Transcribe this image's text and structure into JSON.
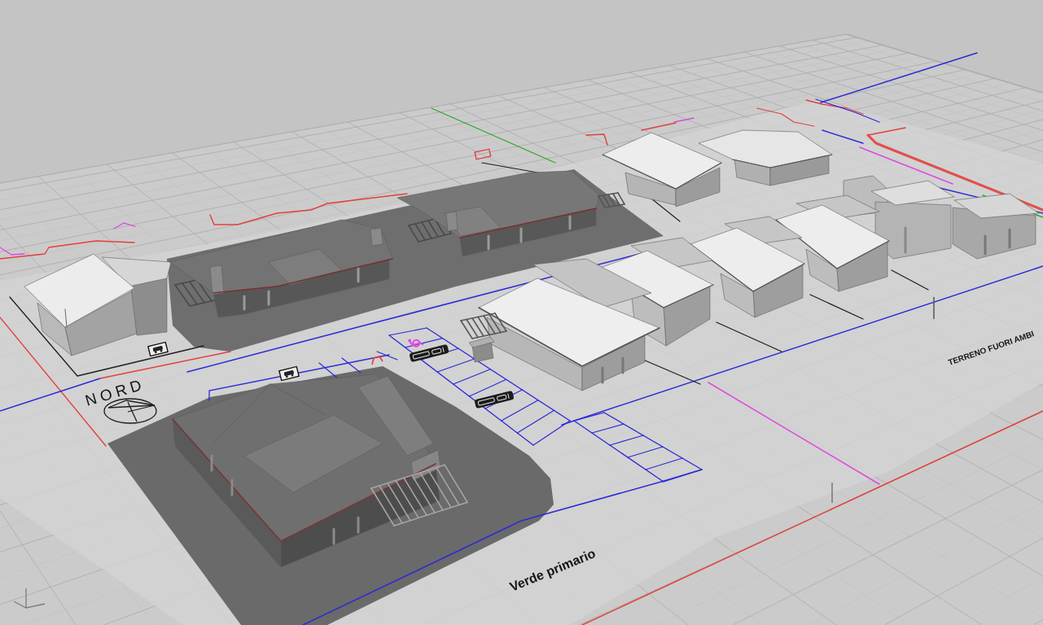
{
  "viewport": {
    "north_arrow": {
      "label": "NORD"
    },
    "zone_labels": [
      {
        "text": "Verde primario"
      },
      {
        "text": "TERRENO FUORI AMBI"
      }
    ]
  }
}
